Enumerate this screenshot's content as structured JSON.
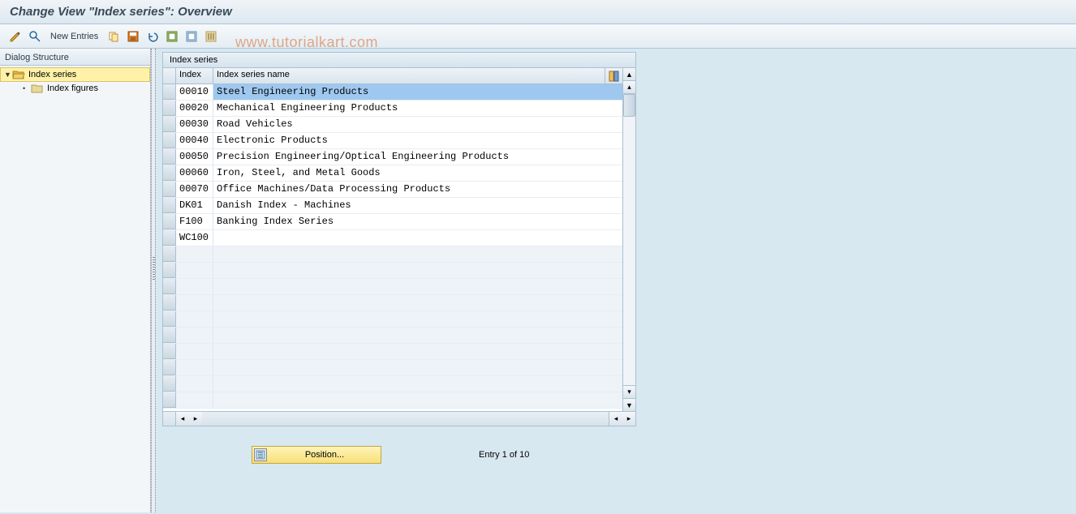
{
  "title": "Change View \"Index series\": Overview",
  "watermark": "www.tutorialkart.com",
  "toolbar": {
    "new_entries": "New Entries"
  },
  "sidebar": {
    "header": "Dialog Structure",
    "root": "Index series",
    "child": "Index figures"
  },
  "panel": {
    "title": "Index series",
    "col_index": "Index",
    "col_name": "Index series name"
  },
  "rows": [
    {
      "index": "00010",
      "name": "Steel Engineering Products",
      "selected": true
    },
    {
      "index": "00020",
      "name": "Mechanical Engineering Products"
    },
    {
      "index": "00030",
      "name": "Road Vehicles"
    },
    {
      "index": "00040",
      "name": "Electronic Products"
    },
    {
      "index": "00050",
      "name": "Precision Engineering/Optical Engineering Products"
    },
    {
      "index": "00060",
      "name": "Iron, Steel, and Metal Goods"
    },
    {
      "index": "00070",
      "name": "Office Machines/Data Processing Products"
    },
    {
      "index": "DK01",
      "name": "Danish Index - Machines"
    },
    {
      "index": "F100",
      "name": "Banking Index Series"
    },
    {
      "index": "WC100",
      "name": ""
    }
  ],
  "empty_rows": 10,
  "footer": {
    "position": "Position...",
    "entry": "Entry 1 of 10"
  }
}
